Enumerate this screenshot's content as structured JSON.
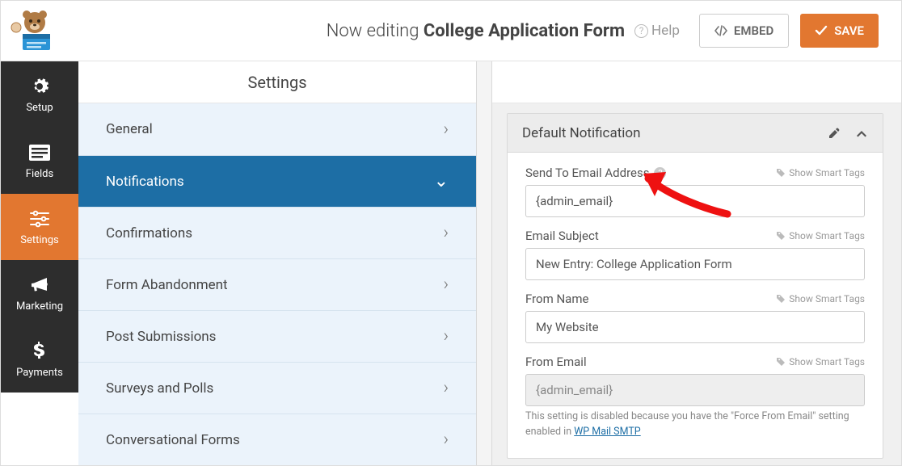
{
  "topbar": {
    "now_editing_prefix": "Now editing ",
    "form_title": "College Application Form",
    "help_label": "Help",
    "embed_label": "EMBED",
    "save_label": "SAVE"
  },
  "iconnav": {
    "items": [
      "Setup",
      "Fields",
      "Settings",
      "Marketing",
      "Payments"
    ],
    "active_index": 2
  },
  "settings": {
    "header": "Settings",
    "items": [
      {
        "label": "General"
      },
      {
        "label": "Notifications",
        "active": true
      },
      {
        "label": "Confirmations"
      },
      {
        "label": "Form Abandonment"
      },
      {
        "label": "Post Submissions"
      },
      {
        "label": "Surveys and Polls"
      },
      {
        "label": "Conversational Forms"
      }
    ]
  },
  "panel": {
    "title": "Default Notification",
    "smart_tags_label": "Show Smart Tags",
    "fields": {
      "send_to": {
        "label": "Send To Email Address",
        "value": "{admin_email}"
      },
      "subject": {
        "label": "Email Subject",
        "value": "New Entry: College Application Form"
      },
      "from_name": {
        "label": "From Name",
        "value": "My Website"
      },
      "from_email": {
        "label": "From Email",
        "value": "{admin_email}",
        "disabled": true
      }
    },
    "from_email_hint_pre": "This setting is disabled because you have the \"Force From Email\" setting enabled in ",
    "from_email_hint_link": "WP Mail SMTP"
  }
}
